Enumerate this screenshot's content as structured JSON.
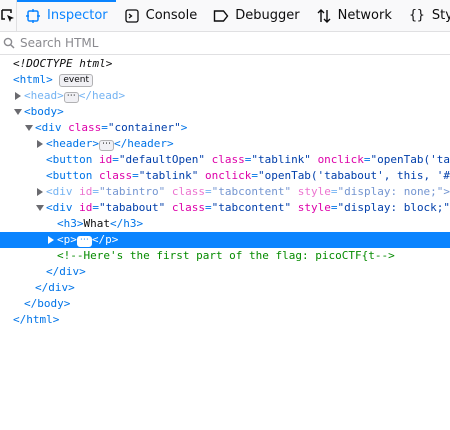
{
  "toolbar": {
    "tabs": [
      {
        "label": "Inspector",
        "icon": "inspector-icon",
        "selected": true
      },
      {
        "label": "Console",
        "icon": "console-icon"
      },
      {
        "label": "Debugger",
        "icon": "debugger-icon"
      },
      {
        "label": "Network",
        "icon": "network-icon"
      },
      {
        "label": "Style Ed",
        "icon": "style-editor-icon"
      }
    ]
  },
  "search": {
    "placeholder": "Search HTML"
  },
  "tree": {
    "doctype": "<!DOCTYPE html>",
    "html_open": "<html>",
    "event_badge": "event",
    "ellipsis": "⋯",
    "head_open": "<head>",
    "head_close": "</head>",
    "body_open": "<body>",
    "div_container": {
      "tag_start": "<div ",
      "attr": "class",
      "eq": "=",
      "value": "\"container\"",
      "end": ">"
    },
    "header_open": "<header>",
    "header_close": "</header>",
    "button1": {
      "tag_start": "<button ",
      "attr1": "id",
      "val1": "\"defaultOpen\"",
      "attr2": "class",
      "val2": "\"tablink\"",
      "attr3": "onclick",
      "val3": "\"openTab('ta"
    },
    "button2": {
      "tag_start": "<button ",
      "attr1": "class",
      "val1": "\"tablink\"",
      "attr2": "onclick",
      "val2": "\"openTab('tababout', this, '#"
    },
    "div_intro": {
      "tag_start": "<div ",
      "attr1": "id",
      "val1": "\"tabintro\"",
      "attr2": "class",
      "val2": "\"tabcontent\"",
      "attr3": "style",
      "val3": "\"display: none;\">"
    },
    "div_about": {
      "tag_start": "<div ",
      "attr1": "id",
      "val1": "\"tababout\"",
      "attr2": "class",
      "val2": "\"tabcontent\"",
      "attr3": "style",
      "val3": "\"display: block;\""
    },
    "h3": {
      "open": "<h3>",
      "text": "What",
      "close": "</h3>"
    },
    "p": {
      "open": "<p>",
      "close": "</p>"
    },
    "comment": "<!--Here's the first part of the flag: picoCTF{t-->",
    "div_close": "</div>",
    "body_close": "</body>",
    "html_close": "</html>"
  },
  "colors": {
    "accent": "#0a84ff",
    "tag": "#0074e8",
    "attr_name": "#dd00a9",
    "attr_value": "#003eaa",
    "comment": "#058b00"
  }
}
